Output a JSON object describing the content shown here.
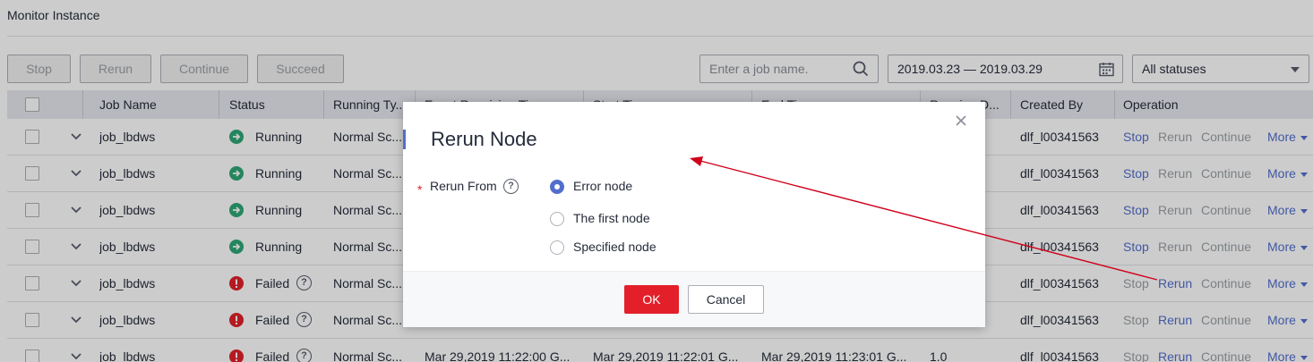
{
  "page": {
    "title": "Monitor Instance"
  },
  "toolbar": {
    "stop": "Stop",
    "rerun": "Rerun",
    "continue": "Continue",
    "succeed": "Succeed",
    "search_placeholder": "Enter a job name.",
    "date_range": "2019.03.23 — 2019.03.29",
    "status_filter": "All statuses"
  },
  "table": {
    "columns": [
      "Job Name",
      "Status",
      "Running Ty...",
      "Event Receiving Ti...",
      "Start Ti...",
      "End Ti...",
      "Running D...",
      "Created By",
      "Operation"
    ],
    "operations": {
      "stop": "Stop",
      "rerun": "Rerun",
      "continue": "Continue",
      "more": "More"
    },
    "rows": [
      {
        "job": "job_lbdws",
        "status": "Running",
        "type": "Normal Sc...",
        "created_by": "dlf_l00341563"
      },
      {
        "job": "job_lbdws",
        "status": "Running",
        "type": "Normal Sc...",
        "created_by": "dlf_l00341563"
      },
      {
        "job": "job_lbdws",
        "status": "Running",
        "type": "Normal Sc...",
        "created_by": "dlf_l00341563"
      },
      {
        "job": "job_lbdws",
        "status": "Running",
        "type": "Normal Sc...",
        "created_by": "dlf_l00341563"
      },
      {
        "job": "job_lbdws",
        "status": "Failed",
        "type": "Normal Sc...",
        "created_by": "dlf_l00341563"
      },
      {
        "job": "job_lbdws",
        "status": "Failed",
        "type": "Normal Sc...",
        "created_by": "dlf_l00341563"
      },
      {
        "job": "job_lbdws",
        "status": "Failed",
        "type": "Normal Sc...",
        "event_time": "Mar 29,2019 11:22:00 G...",
        "start_time": "Mar 29,2019 11:22:01 G...",
        "end_time": "Mar 29,2019 11:23:01 G...",
        "duration": "1.0",
        "created_by": "dlf_l00341563"
      }
    ]
  },
  "dialog": {
    "title": "Rerun Node",
    "field_label": "Rerun From",
    "options": [
      "Error node",
      "The first node",
      "Specified node"
    ],
    "selected": "Error node",
    "ok": "OK",
    "cancel": "Cancel"
  },
  "colors": {
    "accent": "#526ecc",
    "danger": "#e3202a",
    "running": "#2ea876",
    "annotation": "#d0021b"
  }
}
